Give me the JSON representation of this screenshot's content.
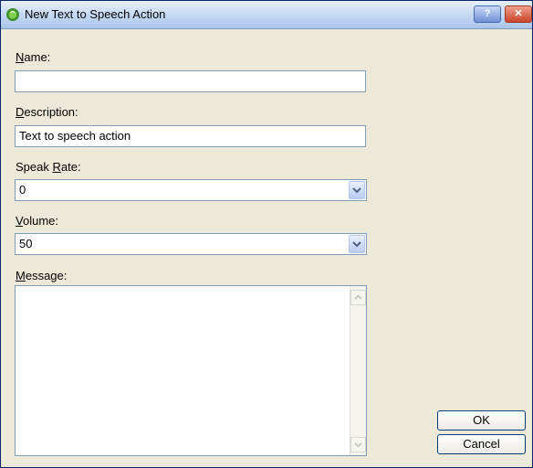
{
  "window": {
    "title": "New Text to Speech Action",
    "help_glyph": "?",
    "close_glyph": "✕"
  },
  "fields": {
    "name": {
      "label_key": "N",
      "label_rest": "ame:",
      "value": ""
    },
    "description": {
      "label_key": "D",
      "label_rest": "escription:",
      "value": "Text to speech action"
    },
    "speak_rate": {
      "label_pre": "Speak ",
      "label_key": "R",
      "label_rest": "ate:",
      "value": "0"
    },
    "volume": {
      "label_key": "V",
      "label_rest": "olume:",
      "value": "50"
    },
    "message": {
      "label_key": "M",
      "label_rest": "essage:",
      "value": ""
    }
  },
  "buttons": {
    "ok": "OK",
    "cancel": "Cancel"
  },
  "icons": {
    "app": "speech-app-icon",
    "dropdown": "chevron-down-icon",
    "scroll_up": "scroll-up-arrow-icon",
    "scroll_down": "scroll-down-arrow-icon"
  },
  "colors": {
    "dialog_bg": "#ece9d8",
    "field_border": "#7f9db9",
    "close_red": "#c9452b"
  }
}
